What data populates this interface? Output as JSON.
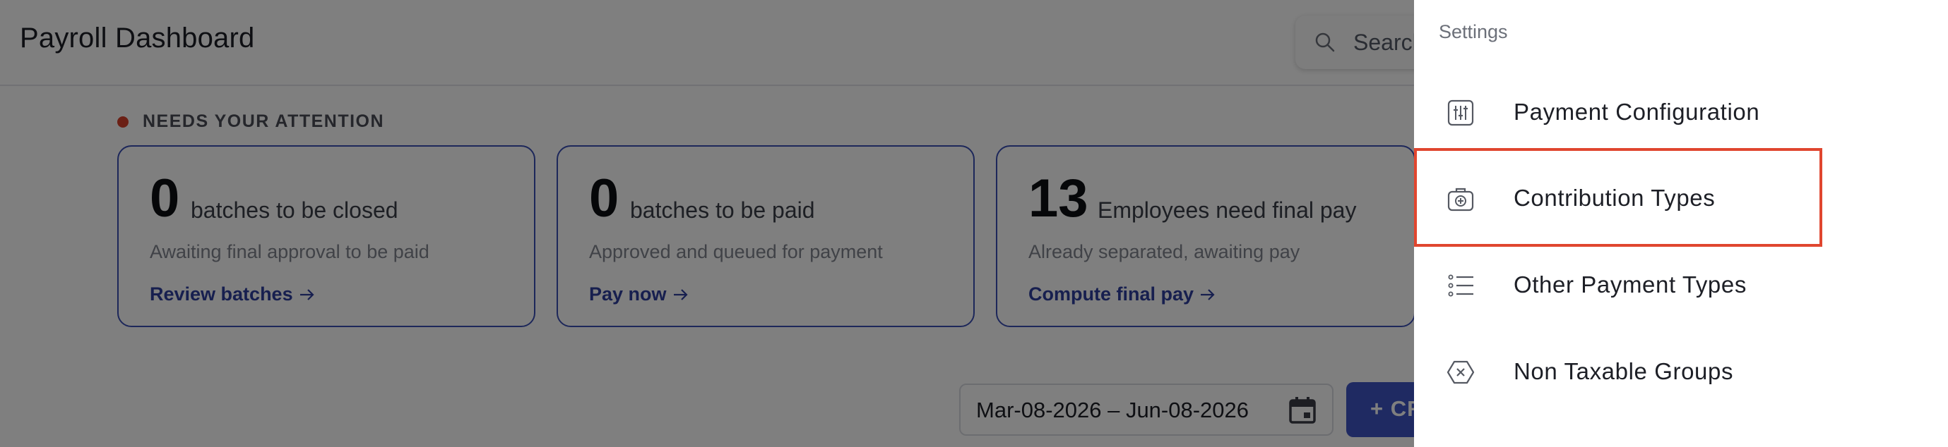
{
  "header": {
    "title": "Payroll Dashboard",
    "search_placeholder": "Search"
  },
  "attention": {
    "label": "NEEDS YOUR ATTENTION",
    "cards": [
      {
        "value": "0",
        "label": "batches to be closed",
        "subtext": "Awaiting final approval to be paid",
        "link": "Review batches"
      },
      {
        "value": "0",
        "label": "batches to be paid",
        "subtext": "Approved and queued for payment",
        "link": "Pay now"
      },
      {
        "value": "13",
        "label": "Employees need final pay",
        "subtext": "Already separated, awaiting pay",
        "link": "Compute final pay"
      }
    ]
  },
  "date_range": {
    "value": "Mar-08-2026 – Jun-08-2026"
  },
  "create_button": {
    "label": "+ CR"
  },
  "settings_drawer": {
    "title": "Settings",
    "items": [
      {
        "label": "Payment Configuration",
        "icon": "sliders-icon"
      },
      {
        "label": "Contribution Types",
        "icon": "medical-bag-icon",
        "highlighted": true
      },
      {
        "label": "Other Payment Types",
        "icon": "list-icon"
      },
      {
        "label": "Non Taxable Groups",
        "icon": "tag-x-icon"
      }
    ]
  },
  "colors": {
    "accent": "#2f3f9e",
    "card_border": "#3a4fb4",
    "highlight": "#e0462f",
    "attention_dot": "#d6402b",
    "overlay": "rgba(0,0,0,0.5)"
  }
}
